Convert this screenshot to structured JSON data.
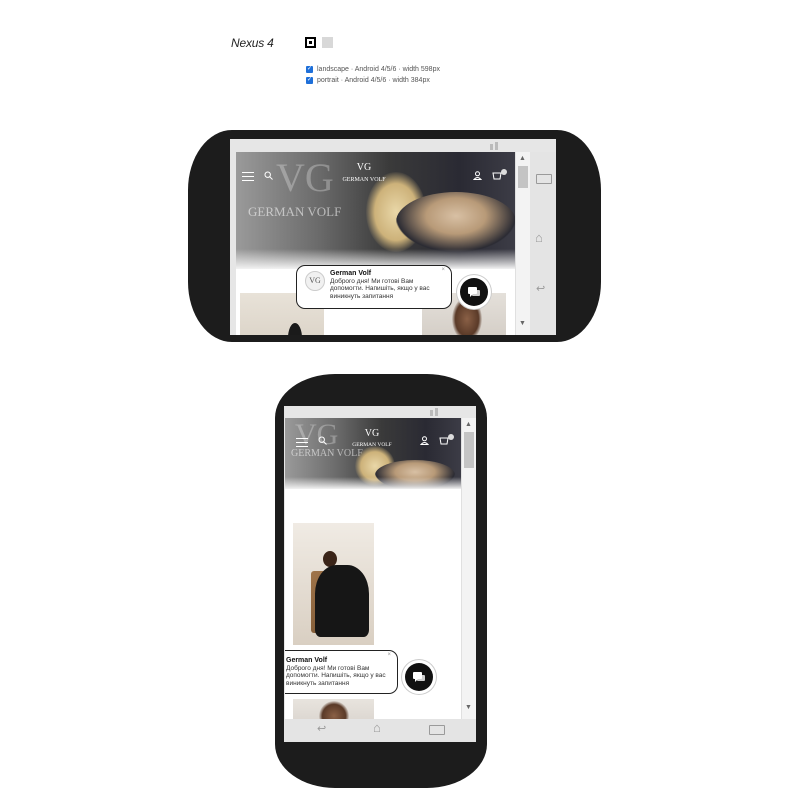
{
  "device": {
    "name": "Nexus 4",
    "orientations": [
      {
        "label": "landscape · Android 4/5/6 · width 598px",
        "checked": true
      },
      {
        "label": "portrait · Android 4/5/6 · width 384px",
        "checked": true
      }
    ]
  },
  "site": {
    "brand": "GERMAN VOLF",
    "monogram": "VG"
  },
  "chat": {
    "name": "German Volf",
    "message": "Доброго дня! Ми готові Вам допомогти. Напишіть, якщо у вас виникнуть запитання",
    "message_landscape_1": "Доброго дня! Ми готові Вам",
    "message_landscape_2": "допомогти. Напишіть, якщо у вас",
    "message_landscape_3": "виникнуть запитання",
    "close": "×"
  },
  "icons": {
    "menu": "hamburger-icon",
    "search": "search-icon",
    "account": "user-icon",
    "cart": "cart-icon",
    "chat": "chat-icon"
  },
  "colors": {
    "phone_body": "#1c1c1c",
    "checkbox": "#1e6fd9",
    "chat_button": "#111111"
  }
}
